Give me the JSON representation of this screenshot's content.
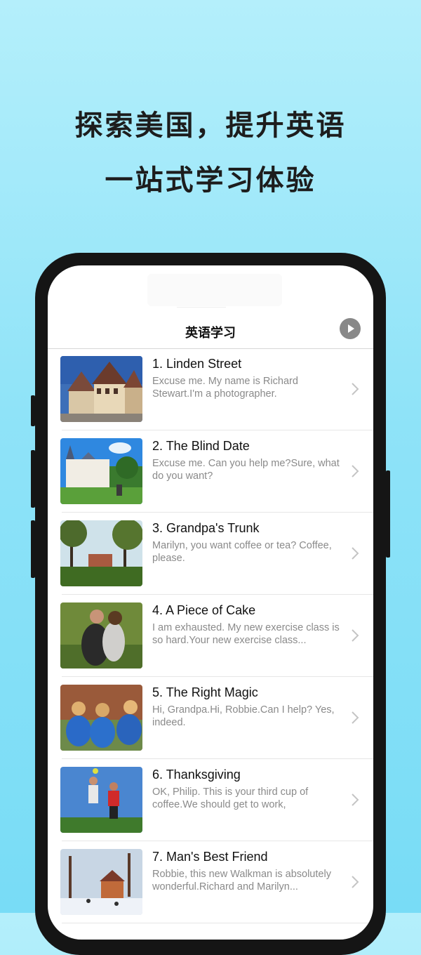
{
  "promo": {
    "headline_line1": "探索美国，提升英语",
    "headline_line2": "一站式学习体验"
  },
  "nav": {
    "title": "英语学习",
    "play_icon": "play-circle-icon"
  },
  "lessons": [
    {
      "title": "1. Linden Street",
      "subtitle": "Excuse me. My name is Richard Stewart.I'm a photographer."
    },
    {
      "title": "2. The Blind Date",
      "subtitle": "Excuse me. Can you help me?Sure, what do you want?"
    },
    {
      "title": "3. Grandpa's Trunk",
      "subtitle": "Marilyn, you want coffee or tea? Coffee, please."
    },
    {
      "title": "4. A Piece of Cake",
      "subtitle": "I am exhausted. My new exercise class is so hard.Your new exercise class..."
    },
    {
      "title": "5. The Right Magic",
      "subtitle": "Hi, Grandpa.Hi, Robbie.Can I help? Yes, indeed."
    },
    {
      "title": "6. Thanksgiving",
      "subtitle": "OK, Philip. This is your third cup of coffee.We should get to work,"
    },
    {
      "title": "7. Man's Best Friend",
      "subtitle": "Robbie, this new Walkman is absolutely wonderful.Richard and Marilyn..."
    }
  ],
  "colors": {
    "background_top": "#b4effb",
    "background_bottom": "#78dcf6",
    "phone_frame": "#151515",
    "chevron": "#c4c4c4"
  }
}
